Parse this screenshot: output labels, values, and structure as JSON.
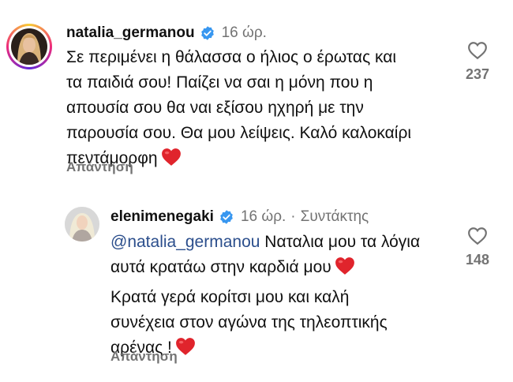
{
  "comments": [
    {
      "username": "natalia_germanou",
      "time": "16 ώρ.",
      "text_lines": [
        "Σε περιμένει η θάλασσα ο ήλιος ο έρωτας και",
        "τα παιδιά σου! Παίζει να σαι η μόνη που η",
        "απουσία σου θα ναι εξίσου ηχηρή με την",
        "παρουσία σου. Θα μου λείψεις. Καλό καλοκαίρι",
        "πεντάμορφη"
      ],
      "reply_label": "Απάντηση",
      "like_count": "237",
      "emoji": "red-heart"
    },
    {
      "username": "elenimenegaki",
      "time": "16 ώρ.",
      "separator": "·",
      "author_label": "Συντάκτης",
      "mention": "@natalia_germanou",
      "line1_rest": " Ναταλια μου τα λόγια",
      "line2": "αυτά κρατάω στην καρδιά μου",
      "para2_lines": [
        "Κρατά γερά κορίτσι μου και καλή",
        "συνέχεια στον αγώνα της τηλεοπτικής",
        "αρένας !"
      ],
      "reply_label": "Απάντηση",
      "like_count": "148",
      "emoji": "red-heart"
    }
  ],
  "colors": {
    "text": "#111111",
    "muted": "#737373",
    "verified": "#3897f0",
    "mention": "#2b4e8c",
    "heart": "#e0242c"
  }
}
